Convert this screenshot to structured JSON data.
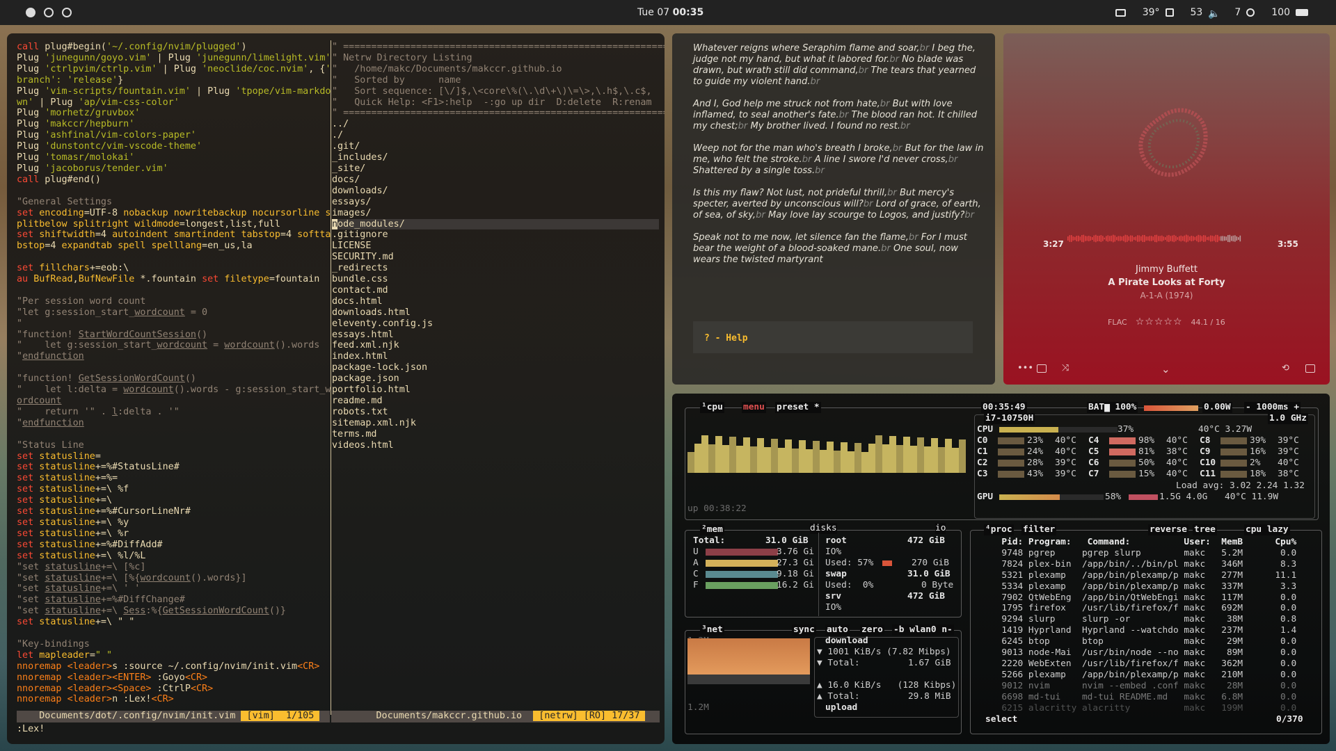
{
  "topbar": {
    "time_day": "Tue 07",
    "time": "00:35",
    "temp": "39°",
    "volume": "53",
    "brightness": "7",
    "battery": "100"
  },
  "vim": {
    "left_status": "    Documents/dot/.config/nvim/init.vim ",
    "left_mode": " [vim] ",
    "left_pos": " 1/105 ",
    "right_status": "        Documents/makccr.github.io  ",
    "right_mode": " [netrw] [RO] 17/37 ",
    "cmdline": ":Lex!"
  },
  "netrw": {
    "header": [
      "\" ==============================================================",
      "\" Netrw Directory Listing",
      "\"   /home/makc/Documents/makccr.github.io",
      "\"   Sorted by      name",
      "\"   Sort sequence: [\\/]$,\\<core\\%(\\.\\d\\+\\)\\=\\>,\\.h$,\\.c$,",
      "\"   Quick Help: <F1>:help  -:go up dir  D:delete  R:renam",
      "\" =============================================================="
    ],
    "entries": [
      "../",
      "./",
      ".git/",
      "_includes/",
      "_site/",
      "docs/",
      "downloads/",
      "essays/",
      "images/",
      "node_modules/",
      ".gitignore",
      "LICENSE",
      "SECURITY.md",
      "_redirects",
      "bundle.css",
      "contact.md",
      "docs.html",
      "downloads.html",
      "eleventy.config.js",
      "essays.html",
      "feed.xml.njk",
      "index.html",
      "package-lock.json",
      "package.json",
      "portfolio.html",
      "readme.md",
      "robots.txt",
      "sitemap.xml.njk",
      "terms.md",
      "videos.html"
    ]
  },
  "poem": {
    "stanzas": [
      [
        "Whatever reigns where Seraphim flame and soar,",
        "I beg the, judge not my hand, but what it labored for.",
        "No blade was drawn, but wrath still did command,",
        "The tears that yearned to guide my violent hand."
      ],
      [
        "And I, God help me struck not from hate,",
        "But with love inflamed, to seal another's fate.",
        "The blood ran hot. It chilled my chest;",
        "My brother lived. I found no rest."
      ],
      [
        "Weep not for the man who's breath I broke,",
        "But for the law in me, who felt the stroke.",
        "A line I swore I'd never cross,",
        "Shattered by a single toss."
      ],
      [
        "Is this my flaw? Not lust, not prideful thrill,",
        "But mercy's specter, averted by unconscious will?",
        "Lord of grace, of earth, of sea, of sky,",
        "May love lay scourge to Logos, and justify?"
      ],
      [
        "Speak not to me now, let silence fan the flame,",
        "For I must bear the weight of a blood-soaked mane.",
        "One soul, now wears the twisted martyrant"
      ]
    ],
    "br_tag": "br",
    "help": "? - Help"
  },
  "music": {
    "elapsed": "3:27",
    "duration": "3:55",
    "progress": 0.88,
    "artist": "Jimmy Buffett",
    "title": "A Pirate Looks at Forty",
    "album": "A-1-A (1974)",
    "format": "FLAC",
    "rating": 0,
    "quality": "44.1 / 16",
    "stars": "☆☆☆☆☆"
  },
  "btop": {
    "cpu_title": "cpu",
    "menu": "menu",
    "preset": "preset *",
    "clock": "00:35:49",
    "bat": "BAT▆ 100%",
    "power": "0.00W",
    "refresh": "- 1000ms +",
    "cpu_model": "i7-10750H",
    "cpu_freq": "1.0 GHz",
    "cpu_total": "37%",
    "cpu_temp": "40°C 3.27W",
    "cores": [
      {
        "n": "C0",
        "p": "23%",
        "t": "40°C"
      },
      {
        "n": "C1",
        "p": "24%",
        "t": "40°C"
      },
      {
        "n": "C2",
        "p": "28%",
        "t": "39°C"
      },
      {
        "n": "C3",
        "p": "43%",
        "t": "39°C"
      },
      {
        "n": "C4",
        "p": "98%",
        "t": "40°C"
      },
      {
        "n": "C5",
        "p": "81%",
        "t": "38°C"
      },
      {
        "n": "C6",
        "p": "50%",
        "t": "40°C"
      },
      {
        "n": "C7",
        "p": "15%",
        "t": "40°C"
      },
      {
        "n": "C8",
        "p": "39%",
        "t": "39°C"
      },
      {
        "n": "C9",
        "p": "16%",
        "t": "39°C"
      },
      {
        "n": "C10",
        "p": "2%",
        "t": "40°C"
      },
      {
        "n": "C11",
        "p": "18%",
        "t": "38°C"
      }
    ],
    "load": "Load avg: 3.02 2.24 1.32",
    "gpu": "GPU",
    "gpu_pct": "58%",
    "gpu_mem": "1.5G 4.0G",
    "gpu_temp": "40°C 11.9W",
    "uptime": "up 00:38:22",
    "mem": {
      "title": "mem",
      "total": "Total:",
      "total_v": "31.0 GiB",
      "rows": [
        {
          "k": "U",
          "v": "3.76 Gi"
        },
        {
          "k": "A",
          "v": "27.3 Gi"
        },
        {
          "k": "C",
          "v": "9.18 Gi"
        },
        {
          "k": "F",
          "v": "16.2 Gi"
        }
      ]
    },
    "disks": {
      "title": "disks",
      "io": "io",
      "root": "root",
      "root_v": "472 GiB",
      "io_lbl": "IO%",
      "used": "Used: 57%",
      "used_v": "270 GiB",
      "swap": "swap",
      "swap_v": "31.0 GiB",
      "used2": "Used:  0%",
      "used2_v": "0 Byte",
      "srv": "srv",
      "srv_v": "472 GiB",
      "io2": "IO%"
    },
    "net": {
      "title": "net",
      "sync": "sync",
      "auto": "auto",
      "zero": "zero",
      "iface": "-b wlan0 n-",
      "scale": "1.2M",
      "scale2": "1.2M",
      "download": "download",
      "dl_rate": "▼ 1001 KiB/s (7.82 Mibps)",
      "dl_total": "▼ Total:         1.67 GiB",
      "ul_rate": "▲ 16.0 KiB/s   (128 Kibps)",
      "ul_total": "▲ Total:         29.8 MiB",
      "upload": "upload"
    },
    "proc": {
      "title": "proc",
      "filter": "filter",
      "reverse": "reverse",
      "tree": "tree",
      "sort": "cpu lazy",
      "headers": "  Pid: Program:   Command:          User:  MemB      Cpu%",
      "rows": [
        [
          "9748",
          "pgrep",
          "pgrep slurp",
          "makc",
          "5.2M",
          "0.0"
        ],
        [
          "7824",
          "plex-bin",
          "/app/bin/../bin/pl",
          "makc",
          "346M",
          "8.3"
        ],
        [
          "5321",
          "plexamp",
          "/app/bin/plexamp/p",
          "makc",
          "277M",
          "11.1"
        ],
        [
          "5334",
          "plexamp",
          "/app/bin/plexamp/p",
          "makc",
          "337M",
          "3.3"
        ],
        [
          "7902",
          "QtWebEng",
          "/app/bin/QtWebEngi",
          "makc",
          "117M",
          "0.0"
        ],
        [
          "1795",
          "firefox",
          "/usr/lib/firefox/f",
          "makc",
          "692M",
          "0.0"
        ],
        [
          "9294",
          "slurp",
          "slurp -or",
          "makc",
          "38M",
          "0.8"
        ],
        [
          "1419",
          "Hyprland",
          "Hyprland --watchdo",
          "makc",
          "237M",
          "1.4"
        ],
        [
          "6245",
          "btop",
          "btop",
          "makc",
          "29M",
          "0.0"
        ],
        [
          "9013",
          "node-Mai",
          "/usr/bin/node --no",
          "makc",
          "89M",
          "0.0"
        ],
        [
          "2220",
          "WebExten",
          "/usr/lib/firefox/f",
          "makc",
          "362M",
          "0.0"
        ],
        [
          "5266",
          "plexamp",
          "/app/bin/plexamp/p",
          "makc",
          "210M",
          "0.0"
        ],
        [
          "9012",
          "nvim",
          "nvim --embed .conf",
          "makc",
          "28M",
          "0.0"
        ],
        [
          "6698",
          "md-tui",
          "md-tui README.md",
          "makc",
          "6.8M",
          "0.0"
        ],
        [
          "6215",
          "alacritty",
          "alacritty",
          "makc",
          "199M",
          "0.0"
        ]
      ],
      "select": "select",
      "count": "0/370"
    }
  }
}
